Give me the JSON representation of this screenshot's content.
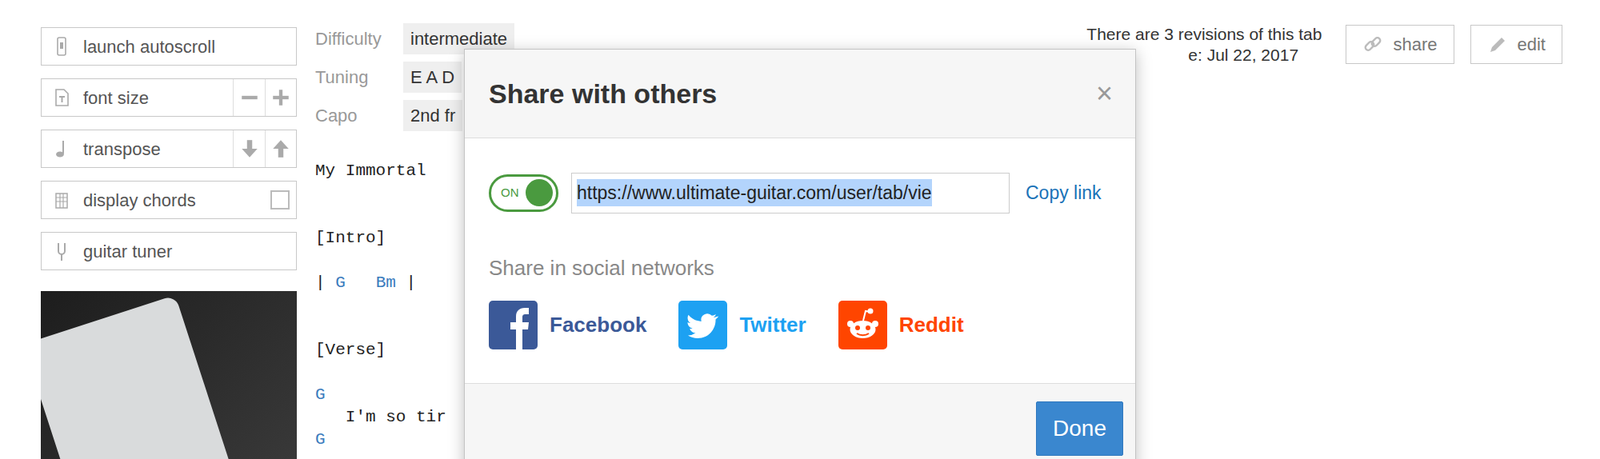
{
  "sidebar": {
    "buttons": [
      {
        "label": "launch autoscroll",
        "kind": "plain"
      },
      {
        "label": "font size",
        "kind": "stepper"
      },
      {
        "label": "transpose",
        "kind": "stepper"
      },
      {
        "label": "display chords",
        "kind": "checkbox",
        "checked": false
      },
      {
        "label": "guitar tuner",
        "kind": "plain"
      }
    ]
  },
  "meta": [
    {
      "label": "Difficulty",
      "value": "intermediate"
    },
    {
      "label": "Tuning",
      "value": "E A D"
    },
    {
      "label": "Capo",
      "value": "2nd fr"
    }
  ],
  "tab": {
    "lines": [
      [
        {
          "text": "My Immortal",
          "chord": false
        }
      ],
      [],
      [],
      [
        {
          "text": "[Intro]",
          "chord": false
        }
      ],
      [],
      [
        {
          "text": "| ",
          "chord": false
        },
        {
          "text": "G",
          "chord": true
        },
        {
          "text": "   ",
          "chord": false
        },
        {
          "text": "Bm",
          "chord": true
        },
        {
          "text": " |",
          "chord": false
        }
      ],
      [],
      [],
      [
        {
          "text": "[Verse]",
          "chord": false
        }
      ],
      [],
      [
        {
          "text": "G",
          "chord": true
        }
      ],
      [
        {
          "text": "   I'm so tir",
          "chord": false
        }
      ],
      [
        {
          "text": "G",
          "chord": true
        }
      ]
    ]
  },
  "info": {
    "revisions": "There are 3 revisions of this tab",
    "updated": "e: Jul 22, 2017"
  },
  "actions": [
    "share",
    "edit"
  ],
  "modal": {
    "title": "Share with others",
    "close": "×",
    "toggle": {
      "label": "ON",
      "on": true
    },
    "url": {
      "text": "https://www.ultimate-guitar.com/user/tab/vie",
      "selected": true
    },
    "copy": "Copy link",
    "social_heading": "Share in social networks",
    "networks": [
      {
        "name": "Facebook",
        "color": "#3b5998"
      },
      {
        "name": "Twitter",
        "color": "#1da1f2"
      },
      {
        "name": "Reddit",
        "color": "#ff4500"
      }
    ],
    "done": "Done"
  }
}
